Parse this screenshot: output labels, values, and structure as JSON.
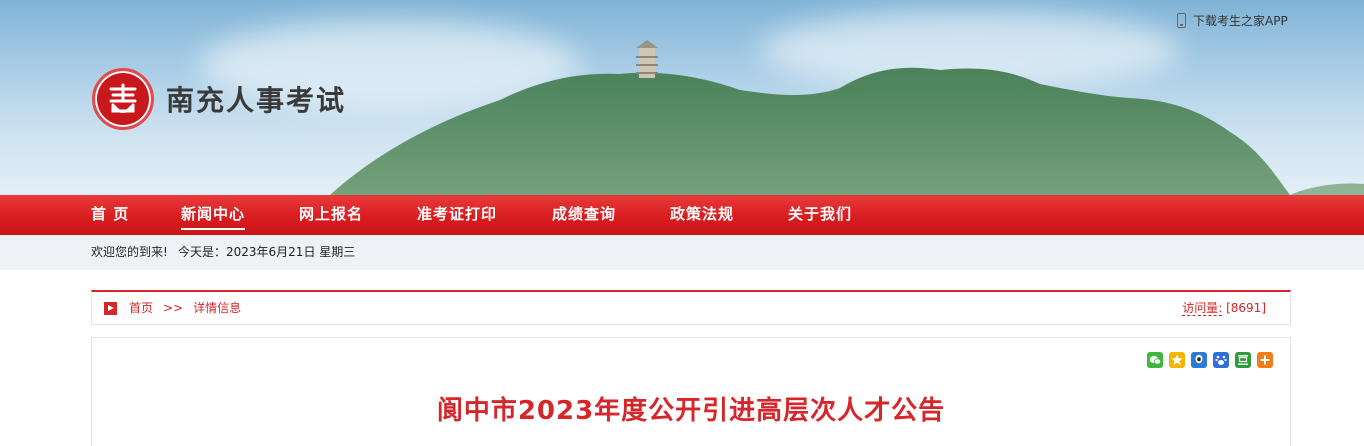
{
  "banner": {
    "app_link": "下载考生之家APP",
    "site_title": "南充人事考试"
  },
  "nav": {
    "items": [
      {
        "label": "首 页"
      },
      {
        "label": "新闻中心",
        "active": true
      },
      {
        "label": "网上报名"
      },
      {
        "label": "准考证打印"
      },
      {
        "label": "成绩查询"
      },
      {
        "label": "政策法规"
      },
      {
        "label": "关于我们"
      }
    ]
  },
  "welcome": {
    "text": "欢迎您的到来!",
    "date": "今天是：2023年6月21日 星期三"
  },
  "breadcrumb": {
    "home": "首页",
    "separator": ">>",
    "current": "详情信息",
    "visits_label": "访问量:",
    "visits_value": "[8691]"
  },
  "share": {
    "icons": [
      "wechat-icon",
      "qzone-icon",
      "qq-icon",
      "baidu-icon",
      "douban-icon",
      "more-icon"
    ]
  },
  "article": {
    "title": "阆中市2023年度公开引进高层次人才公告"
  },
  "colors": {
    "brand_red": "#d7262a",
    "nav_red": "#d91d1f",
    "welcome_bg": "#eef1f6"
  }
}
